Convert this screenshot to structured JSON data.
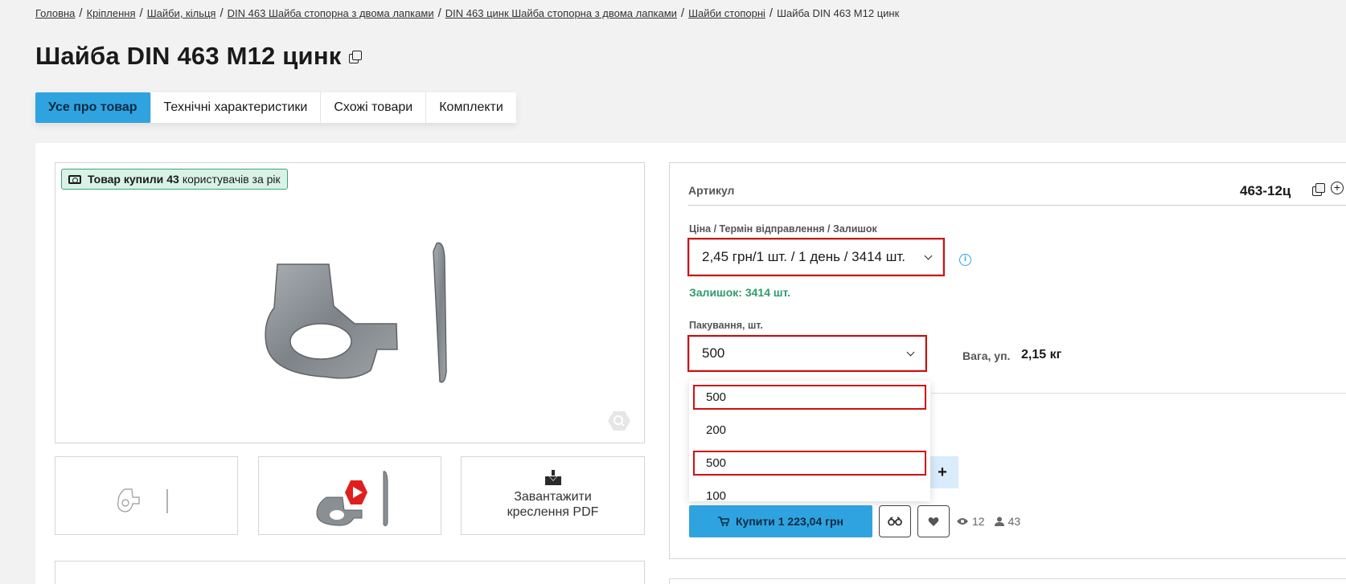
{
  "breadcrumb": {
    "items": [
      "Головна",
      "Кріплення",
      "Шайби, кільця",
      "DIN 463 Шайба стопорна з двома лапками",
      "DIN 463 цинк Шайба стопорна з двома лапками",
      "Шайби стопорні"
    ],
    "current": "Шайба DIN 463 M12 цинк",
    "separator": "/"
  },
  "page_title": "Шайба DIN 463 M12 цинк",
  "tabs": [
    "Усе про товар",
    "Технічні характеристики",
    "Схожі товари",
    "Комплекти"
  ],
  "badge": {
    "prefix": "Товар купили",
    "count": "43",
    "suffix": "користувачів за рік",
    "icon": "ticket-icon"
  },
  "thumbnails": {
    "pdf_label_line1": "Завантажити",
    "pdf_label_line2": "креслення PDF"
  },
  "details": {
    "sku_label": "Артикул",
    "sku_value": "463-12ц",
    "price_label": "Ціна / Термін відправлення / Залишок",
    "price_value": "2,45 грн/1 шт. / 1 день / 3414 шт.",
    "stock_text": "Залишок: 3414 шт.",
    "packaging_label": "Пакування, шт.",
    "packaging_value": "500",
    "packaging_options": [
      "500",
      "200",
      "500",
      "100"
    ],
    "weight_label": "Вага, уп.",
    "weight_value": "2,15 кг",
    "plus_label": "+",
    "buy_label": "Купити 1 223,04 грн",
    "views": "12",
    "buyers": "43"
  },
  "colors": {
    "accent": "#2fa3e0",
    "stock_green": "#2e9b6f",
    "highlight_red": "#d01010",
    "badge_bg": "#d8f2e6"
  }
}
